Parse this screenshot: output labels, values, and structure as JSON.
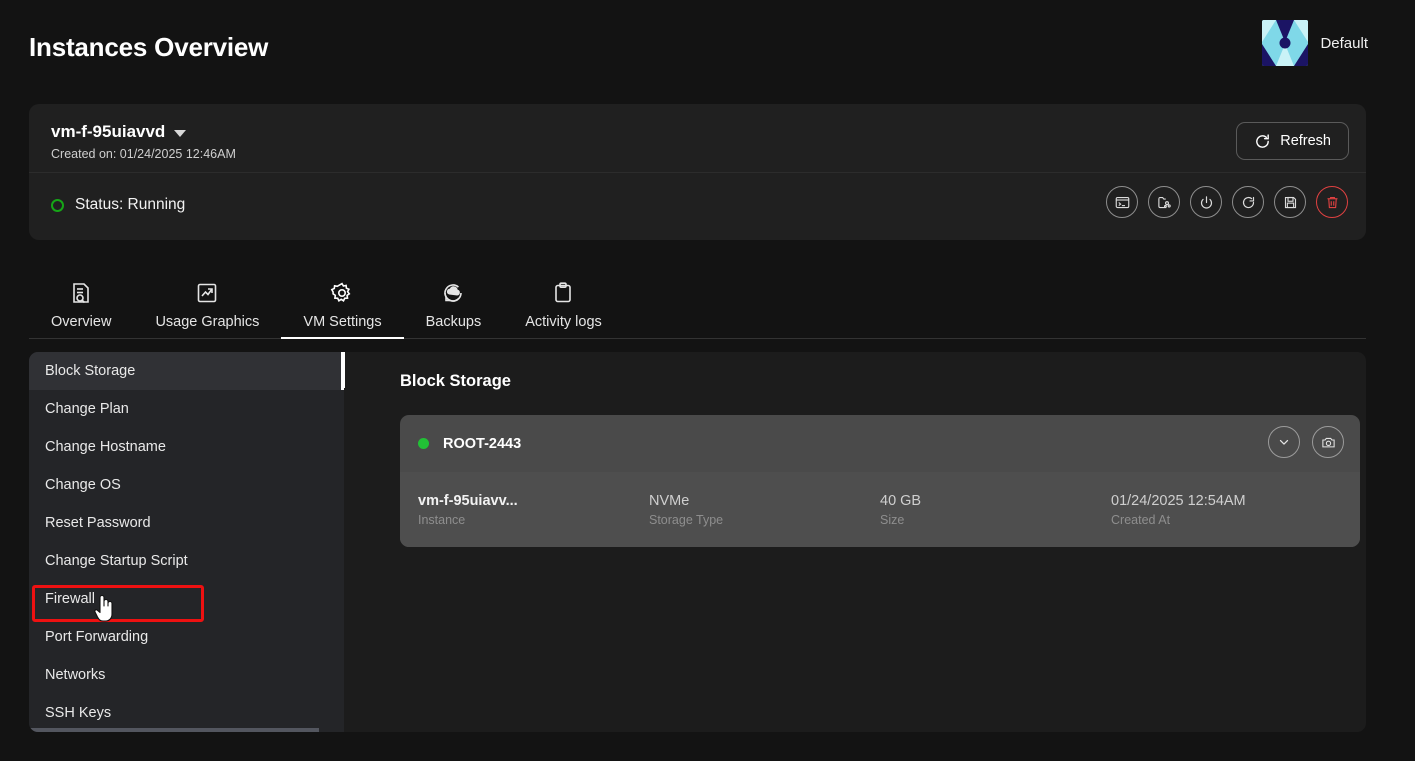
{
  "header": {
    "title": "Instances Overview",
    "org_name": "Default",
    "logo_colors": {
      "dark": "#1b1464",
      "light": "#7fd8e8",
      "pale": "#c9f2f7"
    }
  },
  "instance": {
    "name": "vm-f-95uiavvd",
    "created_label": "Created on: 01/24/2025 12:46AM",
    "refresh_label": "Refresh",
    "status_label": "Status: Running",
    "status_color": "#16a617",
    "actions": [
      {
        "name": "console-icon",
        "title": "Console"
      },
      {
        "name": "folder-settings-icon",
        "title": "Settings"
      },
      {
        "name": "power-icon",
        "title": "Power"
      },
      {
        "name": "restart-icon",
        "title": "Restart"
      },
      {
        "name": "snapshot-disk-icon",
        "title": "Snapshot"
      },
      {
        "name": "delete-icon",
        "title": "Delete",
        "danger": true
      }
    ]
  },
  "tabs": [
    {
      "label": "Overview",
      "icon": "document-search-icon",
      "active": false
    },
    {
      "label": "Usage Graphics",
      "icon": "chart-up-icon",
      "active": false
    },
    {
      "label": "VM Settings",
      "icon": "gear-icon",
      "active": true
    },
    {
      "label": "Backups",
      "icon": "cloud-restore-icon",
      "active": false
    },
    {
      "label": "Activity logs",
      "icon": "clipboard-icon",
      "active": false
    }
  ],
  "sidebar": {
    "items": [
      {
        "label": "Block Storage",
        "active": true
      },
      {
        "label": "Change Plan",
        "active": false
      },
      {
        "label": "Change Hostname",
        "active": false
      },
      {
        "label": "Change OS",
        "active": false
      },
      {
        "label": "Reset Password",
        "active": false
      },
      {
        "label": "Change Startup Script",
        "active": false
      },
      {
        "label": "Firewall",
        "active": false
      },
      {
        "label": "Port Forwarding",
        "active": false
      },
      {
        "label": "Networks",
        "active": false
      },
      {
        "label": "SSH Keys",
        "active": false
      }
    ]
  },
  "content": {
    "title": "Block Storage",
    "volume": {
      "name": "ROOT-2443",
      "status_color": "#22c036",
      "fields": [
        {
          "value": "vm-f-95uiavv...",
          "label": "Instance",
          "dim": false
        },
        {
          "value": "NVMe",
          "label": "Storage Type",
          "dim": true
        },
        {
          "value": "40 GB",
          "label": "Size",
          "dim": true
        },
        {
          "value": "01/24/2025 12:54AM",
          "label": "Created At",
          "dim": true
        }
      ]
    }
  },
  "annotation": {
    "highlight_target": "Firewall",
    "highlight_color": "#ee1111"
  }
}
